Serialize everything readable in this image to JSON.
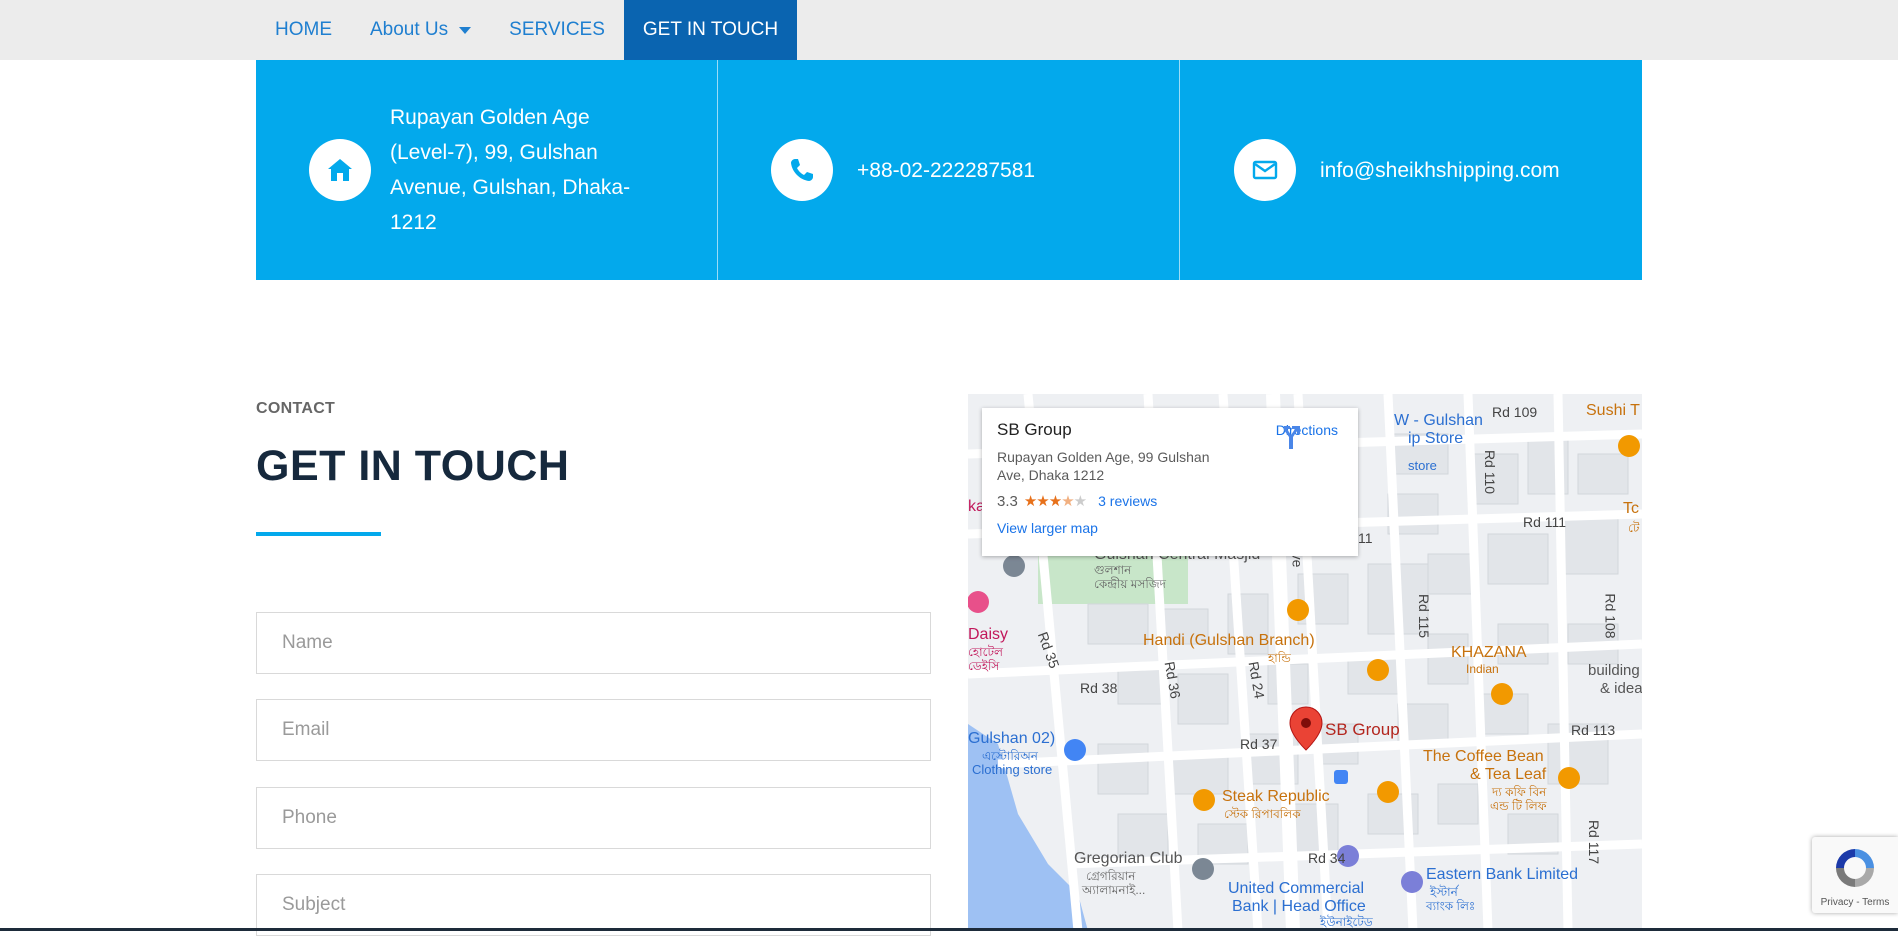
{
  "nav": {
    "items": [
      {
        "label": "HOME"
      },
      {
        "label": "About Us",
        "has_dropdown": true
      },
      {
        "label": "SERVICES"
      },
      {
        "label": "GET IN TOUCH",
        "active": true
      }
    ]
  },
  "info_band": {
    "address": "Rupayan Golden Age (Level-7), 99, Gulshan Avenue, Gulshan, Dhaka-1212",
    "phone": "+88-02-222287581",
    "email": "info@sheikhshipping.com",
    "icons": [
      "home-icon",
      "phone-icon",
      "envelope-icon"
    ],
    "accent_color": "#03a9ec"
  },
  "contact": {
    "kicker": "CONTACT",
    "title": "GET IN TOUCH",
    "fields": {
      "name_placeholder": "Name",
      "email_placeholder": "Email",
      "phone_placeholder": "Phone",
      "subject_placeholder": "Subject"
    }
  },
  "map": {
    "card": {
      "place_name": "SB Group",
      "address": "Rupayan Golden Age, 99 Gulshan Ave, Dhaka 1212",
      "rating": "3.3",
      "reviews": "3 reviews",
      "directions": "Directions",
      "larger_map": "View larger map"
    },
    "labels": {
      "gulshan_lip": "W - Gulshan",
      "lip_store": "ip Store",
      "store": "store",
      "rd109": "Rd 109",
      "sushi": "Sushi T",
      "rd110": "Rd 110",
      "rd111_top": "Rd 111",
      "rd111_left": "11",
      "masjid": "Gulshan Central Masjid",
      "masjid_bn": "গুলশান",
      "masjid_bn2": "কেন্দ্রীয় মসজিদ",
      "ave": "ve",
      "rd115": "Rd 115",
      "rd108": "Rd 108",
      "handi": "Handi (Gulshan Branch)",
      "handi_bn": "হান্ডি",
      "khazana": "KHAZANA",
      "khazana_sub": "Indian",
      "building": "building te",
      "idea": "& idea",
      "daisy": "Daisy",
      "daisy_bn": "হোটেল",
      "daisy_bn2": "ডেইসি",
      "rd35": "Rd 35",
      "rd36": "Rd 36",
      "rd38": "Rd 38",
      "rd24": "Rd 24",
      "sb_group": "SB Group",
      "rd113": "Rd 113",
      "gulshan02": "Gulshan 02)",
      "gulshan02_bn": "এস্টোরিঅন",
      "clothing": "Clothing store",
      "rd37": "Rd 37",
      "coffee_bean": "The Coffee Bean",
      "tea_leaf": "& Tea Leaf",
      "coffee_bn": "দ্য কফি বিন",
      "coffee_bn2": "এন্ড টি লিফ",
      "steak": "Steak Republic",
      "steak_bn": "স্টেক রিপাবলিক",
      "gregorian": "Gregorian Club",
      "gregorian_bn": "গ্রেগরিয়ান",
      "gregorian_bn2": "অ্যালামনাই...",
      "rd34": "Rd 34",
      "eastern": "Eastern Bank Limited",
      "eastern_bn": "ইস্টার্ন",
      "eastern_bn2": "ব্যাংক লিঃ",
      "ucb": "United Commercial",
      "ucb2": "Bank | Head Office",
      "ucb_bn": "ইউনাইটেড",
      "rd117": "Rd 117",
      "tc": "Tc",
      "tc_bn": "টে",
      "ka": "ka"
    }
  },
  "recaptcha": {
    "links": "Privacy - Terms"
  }
}
